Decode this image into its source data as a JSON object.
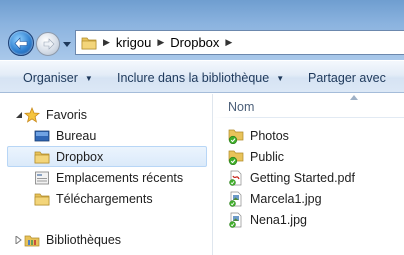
{
  "address": {
    "crumbs": [
      "krigou",
      "Dropbox"
    ]
  },
  "toolbar": {
    "organize_label": "Organiser",
    "include_label": "Inclure dans la bibliothèque",
    "share_label": "Partager avec"
  },
  "nav": {
    "favorites_label": "Favoris",
    "items": [
      {
        "label": "Bureau",
        "icon": "desktop-icon"
      },
      {
        "label": "Dropbox",
        "icon": "dropbox-folder-icon",
        "selected": true
      },
      {
        "label": "Emplacements récents",
        "icon": "recent-places-icon"
      },
      {
        "label": "Téléchargements",
        "icon": "downloads-folder-icon"
      }
    ],
    "libraries_label": "Bibliothèques"
  },
  "list": {
    "column_name": "Nom",
    "files": [
      {
        "name": "Photos",
        "icon": "synced-folder-icon"
      },
      {
        "name": "Public",
        "icon": "synced-folder-icon"
      },
      {
        "name": "Getting Started.pdf",
        "icon": "pdf-file-icon"
      },
      {
        "name": "Marcela1.jpg",
        "icon": "image-file-icon"
      },
      {
        "name": "Nena1.jpg",
        "icon": "image-file-icon"
      }
    ]
  },
  "colors": {
    "title_gradient_top": "#6f9ed0",
    "selection_border": "#b8d6f6",
    "command_text": "#1e395b",
    "sync_green": "#3fae2a"
  }
}
